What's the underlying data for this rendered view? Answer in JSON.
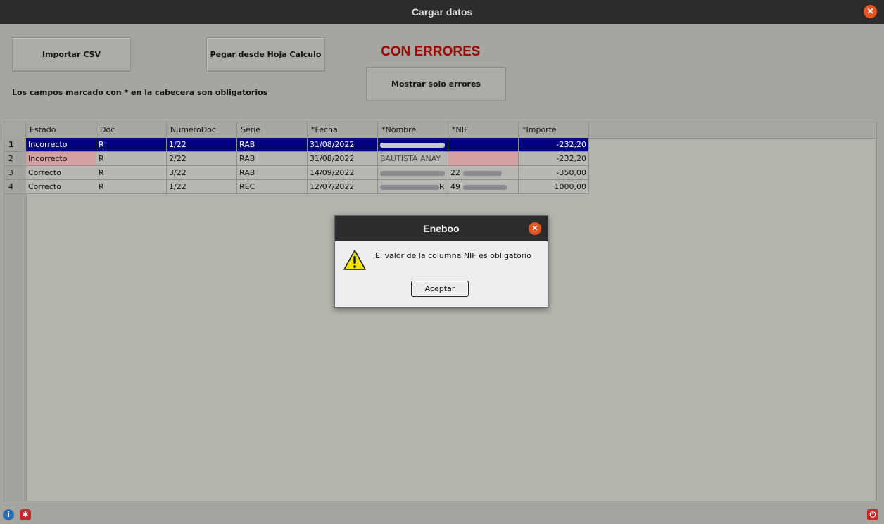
{
  "window": {
    "title": "Cargar datos"
  },
  "toolbar": {
    "import_csv_label": "Importar CSV",
    "paste_sheet_label": "Pegar desde Hoja Calculo",
    "status_label": "CON ERRORES",
    "show_errors_label": "Mostrar solo errores",
    "hint": "Los campos marcado con * en la cabecera son obligatorios"
  },
  "table": {
    "headers": [
      "Estado",
      "Doc",
      "NumeroDoc",
      "Serie",
      "*Fecha",
      "*Nombre",
      "*NIF",
      "*Importe"
    ],
    "rows": [
      {
        "num": "1",
        "estado": "Incorrecto",
        "doc": "R",
        "numerodoc": "1/22",
        "serie": "RAB",
        "fecha": "31/08/2022",
        "importe": "-232,20"
      },
      {
        "num": "2",
        "estado": "Incorrecto",
        "doc": "R",
        "numerodoc": "2/22",
        "serie": "RAB",
        "fecha": "31/08/2022",
        "nombre_partial": "BAUTISTA ANAY",
        "importe": "-232,20"
      },
      {
        "num": "3",
        "estado": "Correcto",
        "doc": "R",
        "numerodoc": "3/22",
        "serie": "RAB",
        "fecha": "14/09/2022",
        "nif_partial": "22",
        "importe": "-350,00"
      },
      {
        "num": "4",
        "estado": "Correcto",
        "doc": "R",
        "numerodoc": "1/22",
        "serie": "REC",
        "fecha": "12/07/2022",
        "nombre_partial": "R",
        "nif_partial": "49",
        "importe": "1000,00"
      }
    ]
  },
  "dialog": {
    "title": "Eneboo",
    "message": "El valor de la columna NIF es obligatorio",
    "ok_label": "Aceptar",
    "icon": "warning-icon"
  },
  "colors": {
    "accent_close": "#e95420",
    "selection": "#000080",
    "error_cell": "#d4a0a0",
    "status_error_text": "#a00000"
  }
}
